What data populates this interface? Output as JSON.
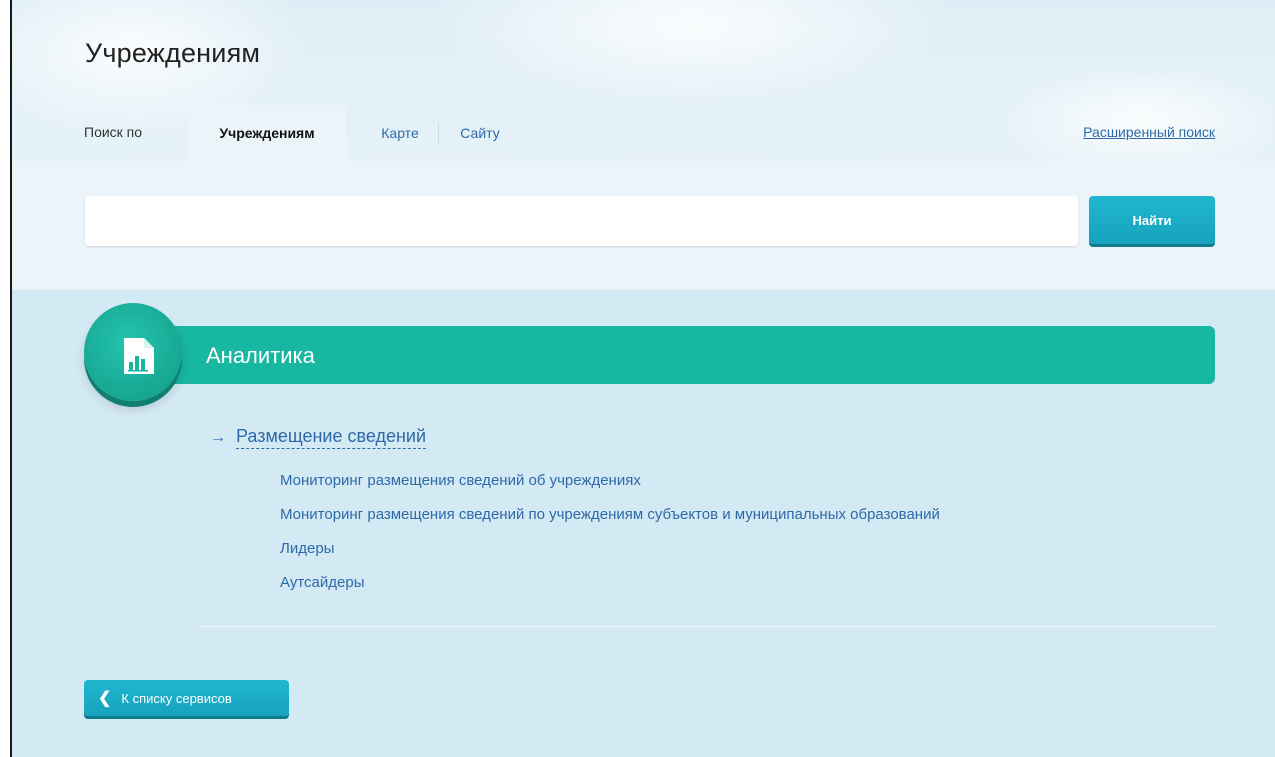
{
  "header": {
    "title": "Учреждениям"
  },
  "tabs": {
    "prefix": "Поиск по",
    "items": [
      {
        "label": "Учреждениям",
        "active": true
      },
      {
        "label": "Карте",
        "active": false
      },
      {
        "label": "Сайту",
        "active": false
      }
    ],
    "advanced_search": "Расширенный поиск"
  },
  "search": {
    "value": "",
    "placeholder": "",
    "button_label": "Найти"
  },
  "section": {
    "title": "Аналитика",
    "icon": "report-chart-icon",
    "group_link": "Размещение сведений",
    "items": [
      "Мониторинг размещения сведений об учреждениях",
      "Мониторинг размещения сведений по учреждениям субъектов и муниципальных образований",
      "Лидеры",
      "Аутсайдеры"
    ]
  },
  "footer": {
    "back_label": "К списку сервисов"
  },
  "colors": {
    "accent_teal": "#17b7a1",
    "button_cyan": "#16a3bd",
    "link_blue": "#2e6aa8",
    "content_bg": "#d3e9f3"
  }
}
